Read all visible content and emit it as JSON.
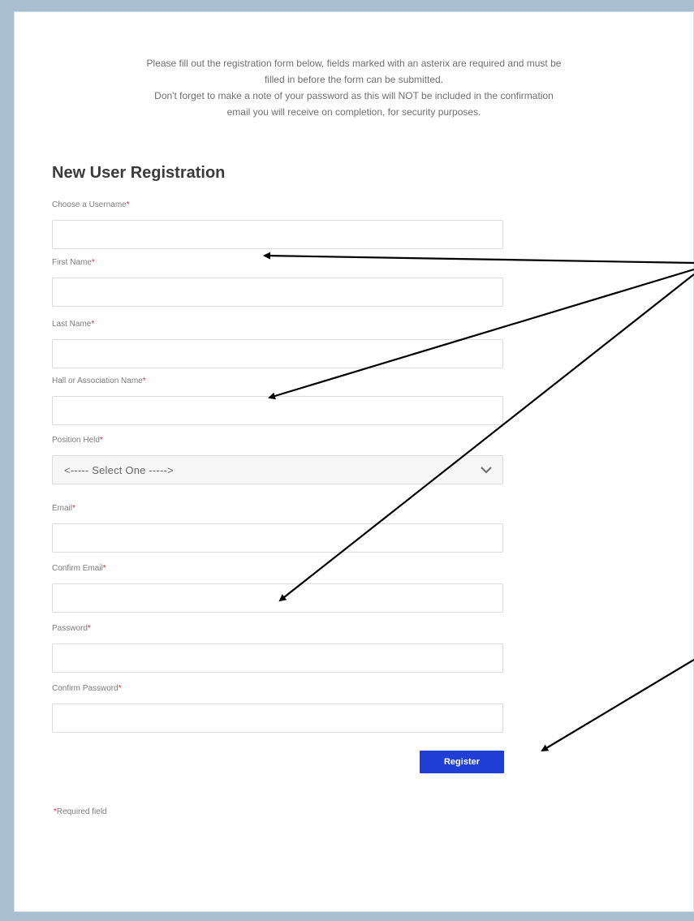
{
  "intro": {
    "line1": "Please fill out the registration form below, fields marked with an asterix are required and must be",
    "line2": "filled in before the form can be submitted.",
    "line3": "Don't forget to make a note of your password as this will NOT be included in the confirmation",
    "line4": "email you will receive on completion, for security purposes."
  },
  "form": {
    "title": "New User Registration",
    "required_marker": "*",
    "fields": [
      {
        "label": "Choose a Username",
        "value": ""
      },
      {
        "label": "First Name",
        "value": ""
      },
      {
        "label": "Last Name",
        "value": ""
      },
      {
        "label": "Hall or Association Name",
        "value": ""
      },
      {
        "label": "Position Held",
        "selected": "<----- Select One ----->"
      },
      {
        "label": "Email",
        "value": ""
      },
      {
        "label": "Confirm Email",
        "value": ""
      },
      {
        "label": "Password",
        "value": ""
      },
      {
        "label": "Confirm Password",
        "value": ""
      }
    ],
    "submit_label": "Register",
    "footnote_marker": "*",
    "footnote": "Required field"
  },
  "colors": {
    "background": "#a9bfd1",
    "button": "#1f3ed6",
    "required_star": "#d9342b"
  }
}
